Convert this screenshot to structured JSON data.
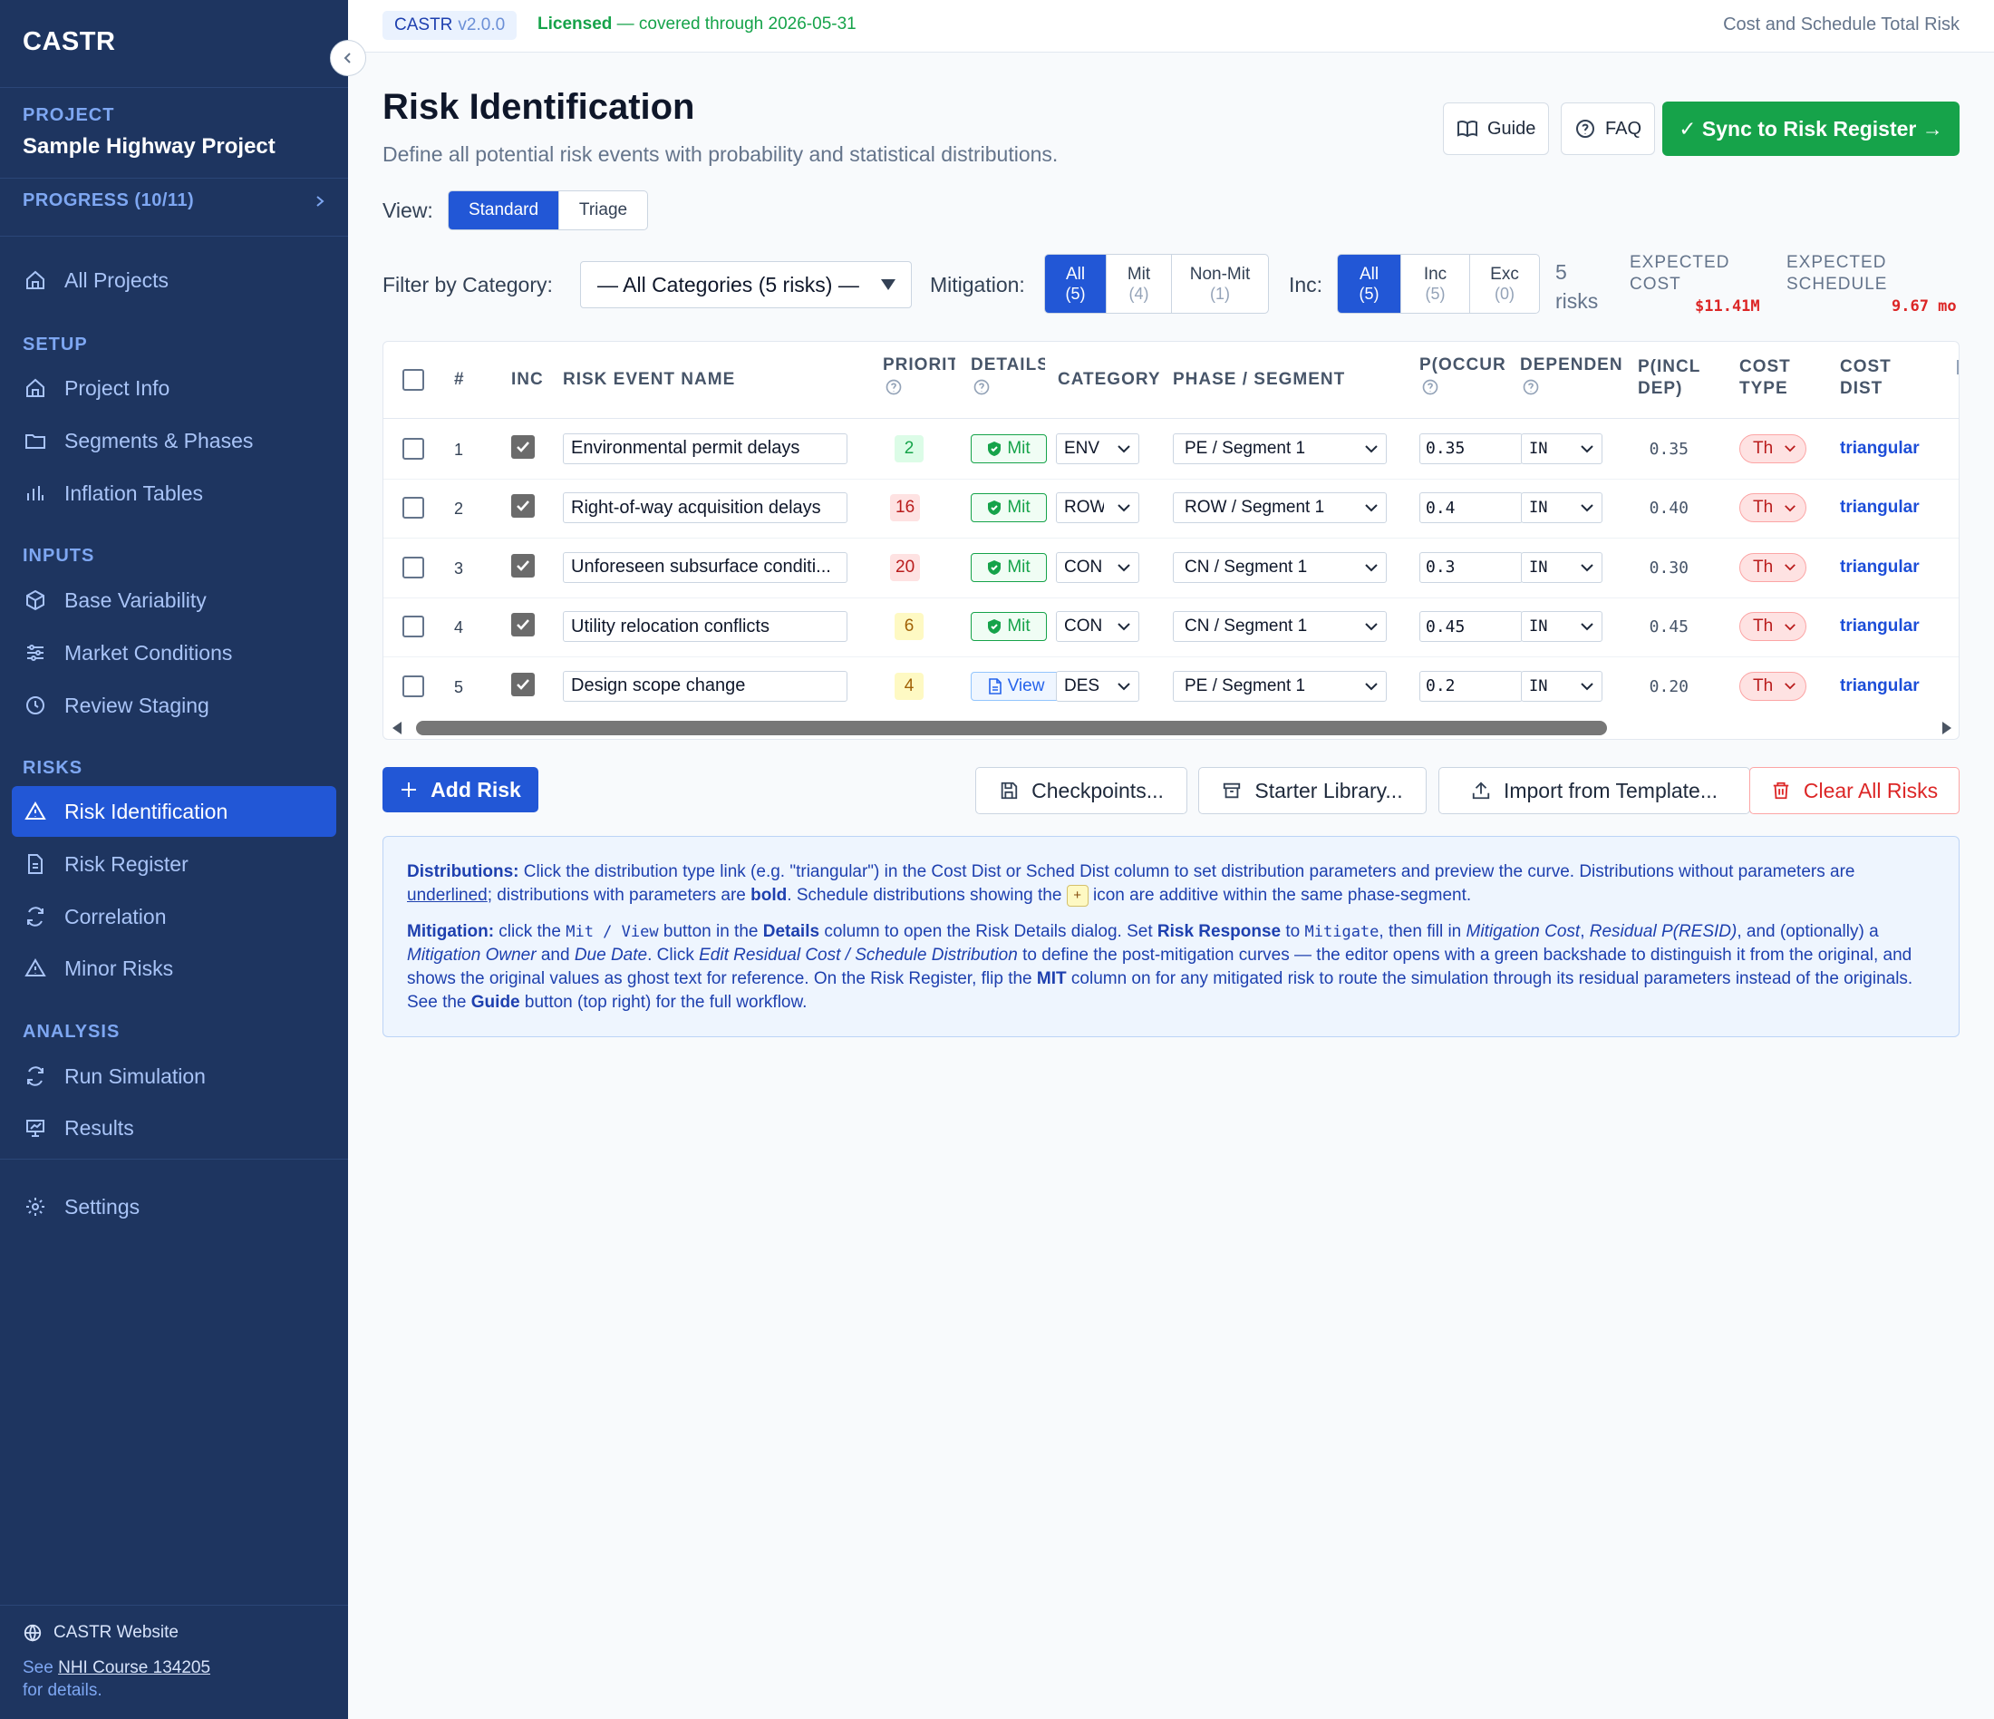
{
  "sidebar": {
    "brand": "CASTR",
    "project_label": "PROJECT",
    "project_name": "Sample Highway Project",
    "progress": "PROGRESS (10/11)",
    "all_projects": "All Projects",
    "sections": {
      "setup": "SETUP",
      "inputs": "INPUTS",
      "risks": "RISKS",
      "analysis": "ANALYSIS"
    },
    "items": {
      "project_info": "Project Info",
      "segments_phases": "Segments & Phases",
      "inflation_tables": "Inflation Tables",
      "base_variability": "Base Variability",
      "market_conditions": "Market Conditions",
      "review_staging": "Review Staging",
      "risk_identification": "Risk Identification",
      "risk_register": "Risk Register",
      "correlation": "Correlation",
      "minor_risks": "Minor Risks",
      "run_simulation": "Run Simulation",
      "results": "Results",
      "settings": "Settings"
    },
    "footer": {
      "website": "CASTR Website",
      "see": "See",
      "course_link": "NHI Course 134205",
      "for_details": "for details."
    }
  },
  "topbar": {
    "app_name": "CASTR",
    "version": "v2.0.0",
    "license_status": "Licensed",
    "license_detail": "— covered through 2026-05-31",
    "app_full_name": "Cost and Schedule Total Risk"
  },
  "header": {
    "title": "Risk Identification",
    "subtitle": "Define all potential risk events with probability and statistical distributions.",
    "guide_label": "Guide",
    "faq_label": "FAQ",
    "sync_label": "✓ Sync to Risk Register →"
  },
  "view": {
    "label": "View:",
    "options": [
      "Standard",
      "Triage"
    ],
    "selected": "Standard"
  },
  "filters": {
    "category_label": "Filter by Category:",
    "category_value": "— All Categories (5 risks) —",
    "mitigation_label": "Mitigation:",
    "mitigation_options": [
      {
        "label": "All",
        "count": "(5)"
      },
      {
        "label": "Mit",
        "count": "(4)"
      },
      {
        "label": "Non-Mit",
        "count": "(1)"
      }
    ],
    "inc_label": "Inc:",
    "inc_options": [
      {
        "label": "All",
        "count": "(5)"
      },
      {
        "label": "Inc",
        "count": "(5)"
      },
      {
        "label": "Exc",
        "count": "(0)"
      }
    ],
    "risk_count_num": "5",
    "risk_count_word": "risks",
    "expected_cost_label_1": "EXPECTED",
    "expected_cost_label_2": "COST",
    "expected_cost_value": "$11.41M",
    "expected_schedule_label_1": "EXPECTED",
    "expected_schedule_label_2": "SCHEDULE",
    "expected_schedule_value": "9.67 mo"
  },
  "table": {
    "headers": {
      "num": "#",
      "inc": "INC",
      "name": "RISK EVENT NAME",
      "priority": "PRIORIT",
      "details": "DETAILS",
      "category": "CATEGORY",
      "phase": "PHASE / SEGMENT",
      "p_occur": "P(OCCUR",
      "dependency": "DEPENDEN",
      "p_incl_1": "P(INCL",
      "p_incl_2": "DEP)",
      "cost_type_1": "COST",
      "cost_type_2": "TYPE",
      "cost_dist_1": "COST",
      "cost_dist_2": "DIST"
    },
    "rows": [
      {
        "num": "1",
        "name": "Environmental permit delays",
        "priority": "2",
        "priority_color": "#16a34a",
        "priority_bg": "#dcfce7",
        "details": "Mit",
        "category": "ENV",
        "phase": "PE / Segment 1",
        "p_occur": "0.35",
        "dependency": "IN",
        "p_incl": "0.35",
        "cost_type": "Th",
        "cost_dist": "triangular"
      },
      {
        "num": "2",
        "name": "Right-of-way acquisition delays",
        "priority": "16",
        "priority_color": "#b91c1c",
        "priority_bg": "#fee2e2",
        "details": "Mit",
        "category": "ROW",
        "phase": "ROW / Segment 1",
        "p_occur": "0.4",
        "dependency": "IN",
        "p_incl": "0.40",
        "cost_type": "Th",
        "cost_dist": "triangular"
      },
      {
        "num": "3",
        "name": "Unforeseen subsurface conditi...",
        "priority": "20",
        "priority_color": "#b91c1c",
        "priority_bg": "#fee2e2",
        "details": "Mit",
        "category": "CON",
        "phase": "CN / Segment 1",
        "p_occur": "0.3",
        "dependency": "IN",
        "p_incl": "0.30",
        "cost_type": "Th",
        "cost_dist": "triangular"
      },
      {
        "num": "4",
        "name": "Utility relocation conflicts",
        "priority": "6",
        "priority_color": "#a16207",
        "priority_bg": "#fef9c3",
        "details": "Mit",
        "category": "CON",
        "phase": "CN / Segment 1",
        "p_occur": "0.45",
        "dependency": "IN",
        "p_incl": "0.45",
        "cost_type": "Th",
        "cost_dist": "triangular"
      },
      {
        "num": "5",
        "name": "Design scope change",
        "priority": "4",
        "priority_color": "#a16207",
        "priority_bg": "#fef9c3",
        "details": "View",
        "category": "DES",
        "phase": "PE / Segment 1",
        "p_occur": "0.2",
        "dependency": "IN",
        "p_incl": "0.20",
        "cost_type": "Th",
        "cost_dist": "triangular"
      }
    ]
  },
  "actions": {
    "add_risk": "Add Risk",
    "checkpoints": "Checkpoints...",
    "starter_library": "Starter Library...",
    "import_template": "Import from Template...",
    "clear_all": "Clear All Risks"
  },
  "info": {
    "dist_title": "Distributions:",
    "dist_text_1": " Click the distribution type link (e.g. \"triangular\") in the Cost Dist or Sched Dist column to set distribution parameters and preview the curve. Distributions without parameters are ",
    "dist_underlined": "underlined",
    "dist_text_2": "; distributions with parameters are ",
    "dist_bold": "bold",
    "dist_text_3": ". Schedule distributions showing the ",
    "dist_plus": "+",
    "dist_text_4": " icon are additive within the same phase-segment.",
    "mit_title": "Mitigation:",
    "mit_t1": " click the ",
    "mit_code1": "Mit / View",
    "mit_t2": " button in the ",
    "mit_b1": "Details",
    "mit_t3": " column to open the Risk Details dialog. Set ",
    "mit_b2": "Risk Response",
    "mit_t4": " to ",
    "mit_code2": "Mitigate",
    "mit_t5": ", then fill in ",
    "mit_i1": "Mitigation Cost",
    "mit_t6": ", ",
    "mit_i2": "Residual P(RESID)",
    "mit_t7": ", and (optionally) a ",
    "mit_i3": "Mitigation Owner",
    "mit_t8": " and ",
    "mit_i4": "Due Date",
    "mit_t9": ". Click ",
    "mit_i5": "Edit Residual Cost / Schedule Distribution",
    "mit_t10": " to define the post-mitigation curves — the editor opens with a green backshade to distinguish it from the original, and shows the original values as ghost text for reference. On the Risk Register, flip the ",
    "mit_b3": "MIT",
    "mit_t11": " column on for any mitigated risk to route the simulation through its residual parameters instead of the originals. See the ",
    "mit_b4": "Guide",
    "mit_t12": " button (top right) for the full workflow."
  },
  "colors": {
    "sidebar_bg": "#1e3560",
    "accent": "#2257d6",
    "success": "#16a34a",
    "danger": "#dc2626"
  }
}
